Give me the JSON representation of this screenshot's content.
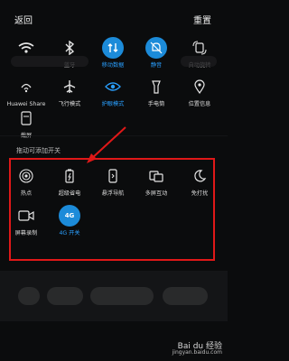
{
  "header": {
    "back_label": "返回",
    "reset_label": "重置"
  },
  "tiles_top": [
    {
      "label": "",
      "icon": "wifi-icon"
    },
    {
      "label": "蓝牙",
      "icon": "bluetooth-icon"
    },
    {
      "label": "移动数据",
      "icon": "mobile-data-icon",
      "active": true
    },
    {
      "label": "静音",
      "icon": "mute-icon",
      "active": true
    },
    {
      "label": "自动旋转",
      "icon": "auto-rotate-icon"
    }
  ],
  "tiles_mid": [
    {
      "label": "Huawei Share",
      "icon": "huawei-share-icon"
    },
    {
      "label": "飞行模式",
      "icon": "airplane-icon"
    },
    {
      "label": "护眼模式",
      "icon": "eye-care-icon",
      "active": true
    },
    {
      "label": "手电筒",
      "icon": "flashlight-icon"
    },
    {
      "label": "位置信息",
      "icon": "location-icon"
    }
  ],
  "tiles_screenshot": [
    {
      "label": "截屏",
      "icon": "screenshot-icon"
    }
  ],
  "drag_hint": "拖动可添加开关",
  "available_tiles_row1": [
    {
      "label": "热点",
      "icon": "hotspot-icon"
    },
    {
      "label": "超级省电",
      "icon": "power-saver-icon"
    },
    {
      "label": "悬浮导航",
      "icon": "floating-nav-icon"
    },
    {
      "label": "多屏互动",
      "icon": "multi-screen-icon"
    },
    {
      "label": "免打扰",
      "icon": "do-not-disturb-icon"
    }
  ],
  "available_tiles_row2": [
    {
      "label": "屏幕录制",
      "icon": "screen-record-icon"
    },
    {
      "label": "4G 开关",
      "icon": "4g-switch-icon",
      "active": true,
      "badge": "4G"
    }
  ],
  "watermark": {
    "brand": "Bai du 经验",
    "url": "jingyan.baidu.com"
  },
  "colors": {
    "accent": "#1c8bd9",
    "highlight_box": "#e01818",
    "background": "#0b0c0d"
  }
}
